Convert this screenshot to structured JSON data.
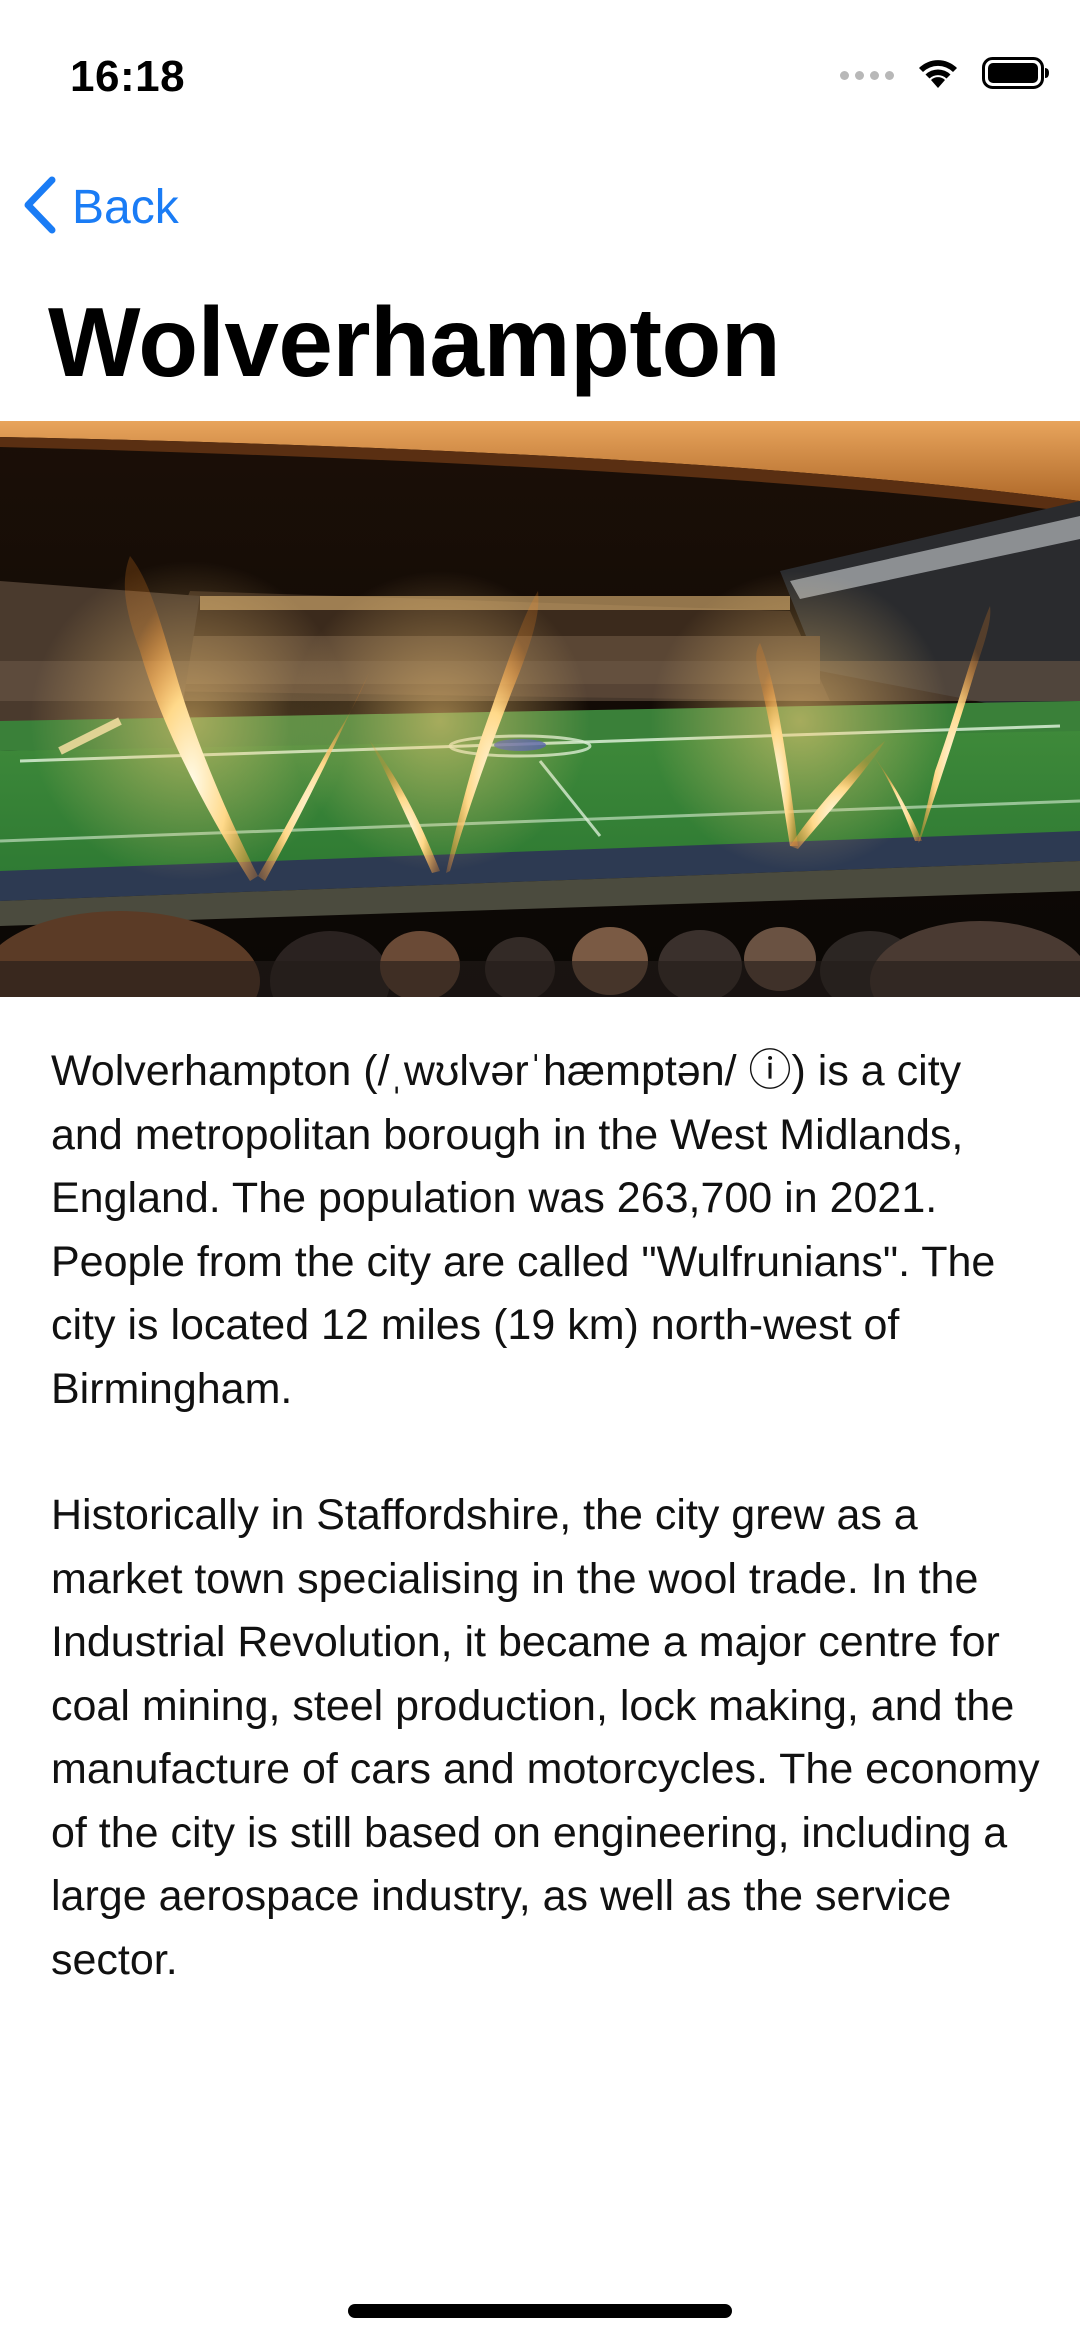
{
  "status_bar": {
    "time": "16:18",
    "icons": [
      "cellular-dots-icon",
      "wifi-icon",
      "battery-icon"
    ]
  },
  "nav": {
    "back_label": "Back",
    "back_icon": "chevron-left-icon",
    "accent_color": "#1a7cf5"
  },
  "page": {
    "title": "Wolverhampton"
  },
  "hero_image": {
    "subject": "stadium-fireworks-photo"
  },
  "article": {
    "paragraphs": [
      "Wolverhampton (/ˌwʊlvərˈhæmptən/ ⓘ) is a city and metropolitan borough in the West Midlands, England. The population was 263,700 in 2021. People from the city are called \"Wulfrunians\". The city is located 12 miles (19 km) north-west of Birmingham.",
      "Historically in Staffordshire, the city grew as a market town specialising in the wool trade. In the Industrial Revolution, it became a major centre for coal mining, steel production, lock making, and the manufacture of cars and motorcycles. The economy of the city is still based on engineering, including a large aerospace industry, as well as the service sector."
    ]
  }
}
